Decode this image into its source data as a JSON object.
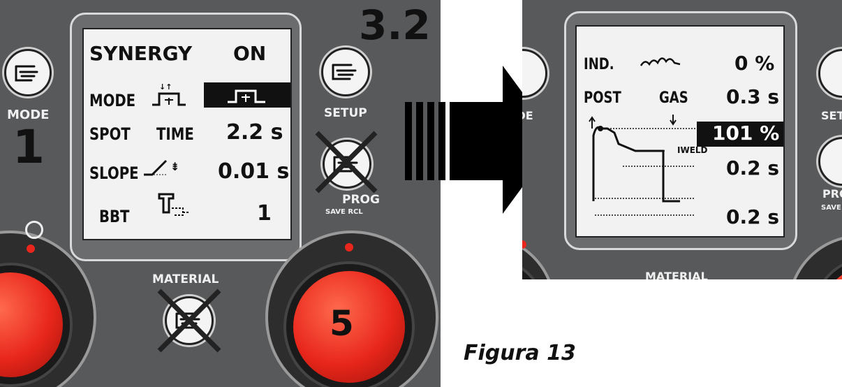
{
  "left_panel": {
    "step_number": "3.2",
    "lcd": {
      "rows": [
        {
          "label": "SYNERGY",
          "value": "ON"
        },
        {
          "label": "MODE",
          "value": ""
        },
        {
          "label": "SPOT",
          "mid": "TIME",
          "value": "2.2 s"
        },
        {
          "label": "SLOPE",
          "value": "0.01 s"
        },
        {
          "label": "BBT",
          "value": "1"
        }
      ]
    },
    "buttons": {
      "mode": {
        "label": "MODE",
        "number": "1",
        "icon": "hand-pointer-icon"
      },
      "setup": {
        "label": "SETUP",
        "icon": "hand-pointer-icon"
      },
      "prog": {
        "label": "PROG",
        "sub": "SAVE  RCL",
        "icon": "hand-pointer-icon",
        "crossed": true
      },
      "material": {
        "label": "MATERIAL",
        "icon": "hand-pointer-icon",
        "crossed": true
      }
    },
    "knob_right": {
      "number": "5"
    }
  },
  "right_panel": {
    "lcd": {
      "ind_label": "IND.",
      "ind_value": "0 %",
      "post_label": "POST",
      "gas_label": "GAS",
      "gas_value": "0.3 s",
      "highlight_value": "101 %",
      "iweld_label": "IWELD",
      "value_a": "0.2 s",
      "value_b": "0.2 s"
    },
    "labels": {
      "setup": "SETUP",
      "prog": "PROG",
      "save": "SAVE",
      "mode": "MODE",
      "material": "MATERIAL"
    }
  },
  "caption": "Figura 13",
  "colors": {
    "panel": "#58595b",
    "lcd": "#f2f2f2",
    "knob": "#e8261b",
    "arrow": "#000000"
  }
}
